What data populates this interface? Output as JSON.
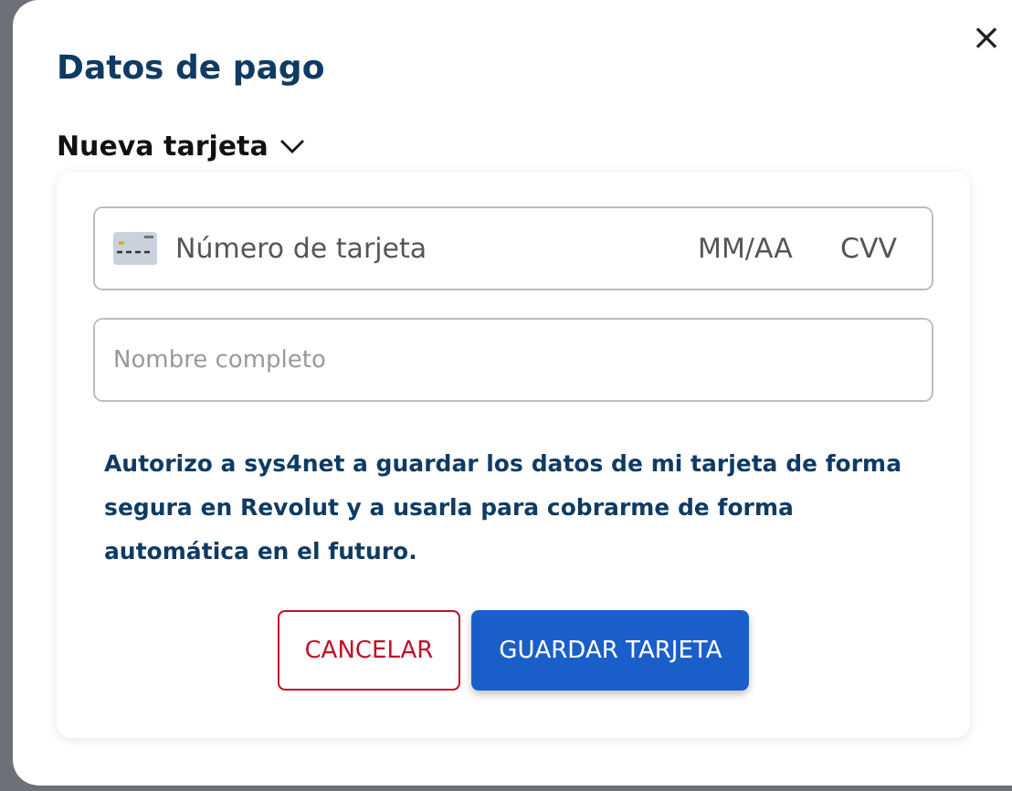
{
  "dialog": {
    "title": "Datos de pago",
    "close": "×"
  },
  "card_selector": {
    "label": "Nueva tarjeta",
    "expanded": false
  },
  "card_field": {
    "placeholder": "Número de tarjeta",
    "expiry_placeholder": "MM/AA",
    "cvv_placeholder": "CVV"
  },
  "name_field": {
    "placeholder": "Nombre completo"
  },
  "consent": "Autorizo a sys4net a guardar los datos de mi tarjeta de forma segura en Revolut y a usarla para cobrarme de forma automática en el futuro.",
  "buttons": [
    {
      "label": "CANCELAR",
      "kind": "secondary"
    },
    {
      "label": "GUARDAR TARJETA",
      "kind": "primary"
    }
  ]
}
